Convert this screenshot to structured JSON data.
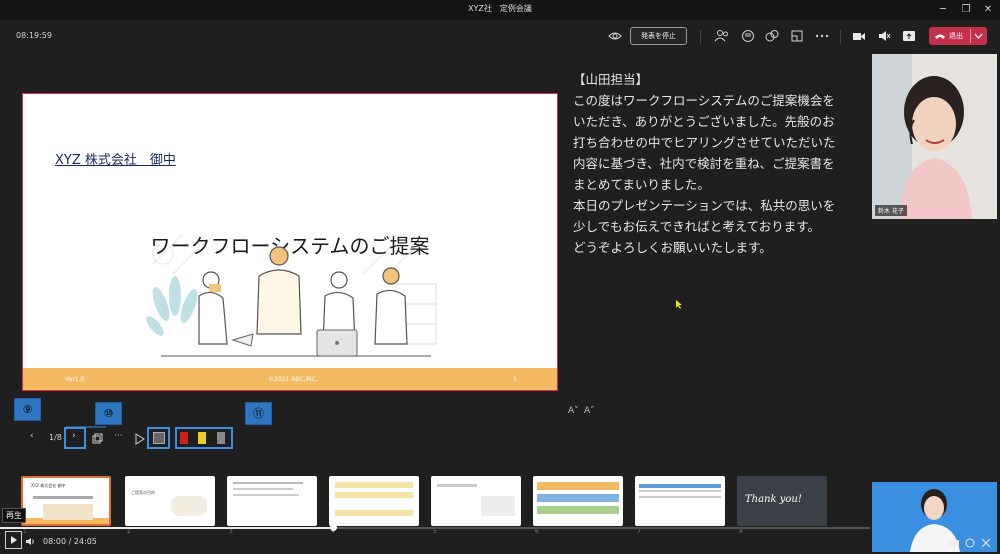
{
  "window": {
    "title": "XYZ社　定例会議"
  },
  "toolbar": {
    "time": "08:19:59",
    "stop_presenting": "発表を停止",
    "leave": "退出"
  },
  "slide": {
    "client": "XYZ 株式会社　御中",
    "title": "ワークフローシステムのご提案",
    "footer_left": "Ver1.0",
    "footer_center": "©2021 ABC,INC.",
    "footer_right": "1"
  },
  "notes": {
    "paragraphs": [
      "【山田担当】",
      "この度はワークフローシステムのご提案機会をいただき、ありがとうございました。先般のお打ち合わせの中でヒアリングさせていただいた内容に基づき、社内で検討を重ね、ご提案書をまとめてまいりました。",
      "本日のプレゼンテーションでは、私共の思いを少しでもお伝えできればと考えております。",
      "どうぞよろしくお願いいたします。"
    ],
    "font_decrease": "A˅",
    "font_increase": "A˄"
  },
  "slide_controls": {
    "page": "1/8",
    "callouts": [
      "⑨",
      "⑩",
      "⑪"
    ]
  },
  "thumbnails": [
    {
      "num": "1",
      "text": "XYZ 株式会社 御中"
    },
    {
      "num": "2",
      "text": "ご提案の目的"
    },
    {
      "num": "3",
      "text": ""
    },
    {
      "num": "4",
      "text": ""
    },
    {
      "num": "5",
      "text": ""
    },
    {
      "num": "6",
      "text": ""
    },
    {
      "num": "7",
      "text": ""
    },
    {
      "num": "8",
      "text": "Thank you!"
    }
  ],
  "player": {
    "tooltip": "再生",
    "time": "08:00 / 24:05",
    "progress": 0.38
  },
  "participants": [
    {
      "name": "鈴木 花子"
    }
  ],
  "colors": {
    "accent_red": "#c4314b",
    "callout_blue": "#2f76c0",
    "slide_footer": "#f5b962"
  }
}
